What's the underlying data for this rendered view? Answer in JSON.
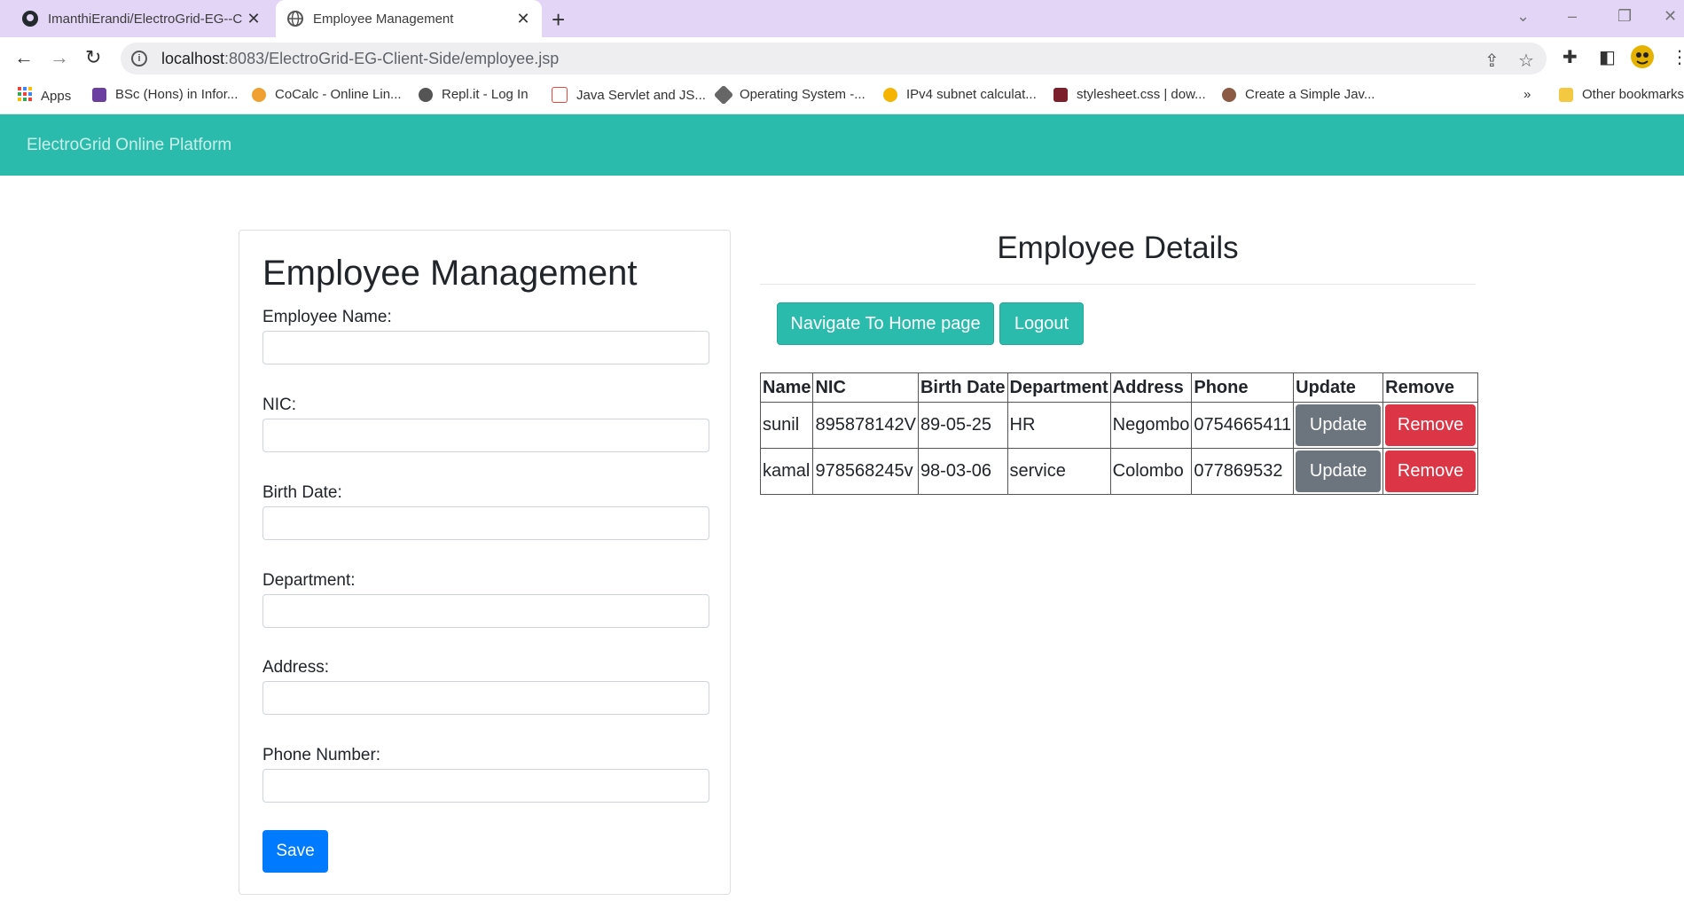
{
  "browser": {
    "tabs": [
      {
        "title": "ImanthiErandi/ElectroGrid-EG--C",
        "icon": "github-icon"
      },
      {
        "title": "Employee Management",
        "icon": "globe-icon"
      }
    ],
    "url_host": "localhost",
    "url_rest": ":8083/ElectroGrid-EG-Client-Side/employee.jsp",
    "bookmarks": [
      {
        "label": "Apps",
        "color": "#e8453c"
      },
      {
        "label": "BSc (Hons) in Infor...",
        "color": "#6a3fa0"
      },
      {
        "label": "CoCalc - Online Lin...",
        "color": "#f0a030"
      },
      {
        "label": "Repl.it - Log In",
        "color": "#555555"
      },
      {
        "label": "Java Servlet and JS...",
        "color": "#e8453c"
      },
      {
        "label": "Operating System -...",
        "color": "#666666"
      },
      {
        "label": "IPv4 subnet calculat...",
        "color": "#f5b400"
      },
      {
        "label": "stylesheet.css | dow...",
        "color": "#7a1f2b"
      },
      {
        "label": "Create a Simple Jav...",
        "color": "#8a5a44"
      }
    ],
    "other_bookmarks": "Other bookmarks"
  },
  "navbar": {
    "brand": "ElectroGrid Online Platform"
  },
  "form": {
    "title": "Employee Management",
    "fields": [
      {
        "label": "Employee Name:",
        "value": ""
      },
      {
        "label": "NIC:",
        "value": ""
      },
      {
        "label": "Birth Date:",
        "value": ""
      },
      {
        "label": "Department:",
        "value": ""
      },
      {
        "label": "Address:",
        "value": ""
      },
      {
        "label": "Phone Number:",
        "value": ""
      }
    ],
    "save_label": "Save"
  },
  "details": {
    "title": "Employee Details",
    "home_button": "Navigate To Home page",
    "logout_button": "Logout",
    "columns": [
      "Name",
      "NIC",
      "Birth Date",
      "Department",
      "Address",
      "Phone",
      "Update",
      "Remove"
    ],
    "rows": [
      {
        "name": "sunil",
        "nic": "895878142V",
        "birth_date": "89-05-25",
        "department": "HR",
        "address": "Negombo",
        "phone": "0754665411"
      },
      {
        "name": "kamal",
        "nic": "978568245v",
        "birth_date": "98-03-06",
        "department": "service",
        "address": "Colombo",
        "phone": "077869532"
      }
    ],
    "update_label": "Update",
    "remove_label": "Remove"
  },
  "colors": {
    "navbar": "#2bbbad",
    "tabbar": "#e3d5f6",
    "save_button": "#007bff",
    "update_button": "#6c757d",
    "remove_button": "#dc3545"
  }
}
